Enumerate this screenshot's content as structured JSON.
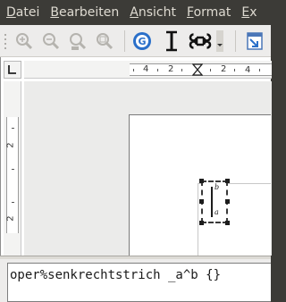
{
  "menubar": {
    "items": [
      {
        "mnemonic": "D",
        "rest": "atei"
      },
      {
        "mnemonic": "B",
        "rest": "earbeiten"
      },
      {
        "mnemonic": "A",
        "rest": "nsicht"
      },
      {
        "mnemonic": "F",
        "rest": "ormat"
      },
      {
        "mnemonic": "E",
        "rest": "x"
      }
    ]
  },
  "rulers": {
    "horizontal": [
      "4",
      "2",
      "2",
      "4"
    ],
    "vertical": [
      "2",
      "2"
    ]
  },
  "formula": {
    "upper_limit": "b",
    "lower_limit": "a"
  },
  "command": {
    "text": "oper%senkrechtstrich _a^b {}"
  },
  "colors": {
    "menubar_bg": "#3c3b37",
    "menubar_text": "#dfdbd2",
    "toolbar_bg": "#edeceb",
    "accent_blue": "#2a6fc9"
  }
}
